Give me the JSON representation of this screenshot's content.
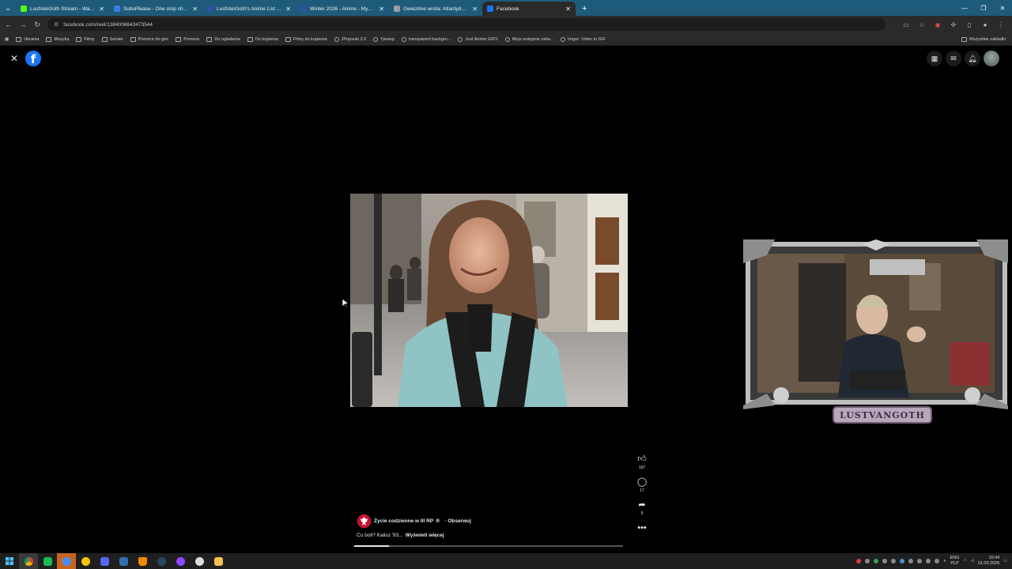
{
  "browser": {
    "tabs": [
      {
        "title": "LustVanGoth Stream - Watch Li",
        "favicon_color": "#53fc18",
        "active": false
      },
      {
        "title": "SubsPlease - One stop shop fo",
        "favicon_color": "#3b7de0",
        "active": false
      },
      {
        "title": "LustVanGoth's Anime List - My",
        "favicon_color": "#2e51a2",
        "active": false
      },
      {
        "title": "Winter 2026 - Anime - MyAnim",
        "favicon_color": "#2e51a2",
        "active": false
      },
      {
        "title": "Gwiezdne wrota: Atlantyda / St",
        "favicon_color": "#9aa0a6",
        "active": false
      },
      {
        "title": "Facebook",
        "favicon_color": "#1877f2",
        "active": true
      }
    ],
    "url": "facebook.com/reel/1384006643473544",
    "bookmarks": [
      {
        "label": "Ubrania",
        "type": "folder"
      },
      {
        "label": "Muzyka",
        "type": "folder"
      },
      {
        "label": "Filmy",
        "type": "folder"
      },
      {
        "label": "Seriale",
        "type": "folder"
      },
      {
        "label": "Pomoce do gier",
        "type": "folder"
      },
      {
        "label": "Pomoce",
        "type": "folder"
      },
      {
        "label": "Do ogladania",
        "type": "folder"
      },
      {
        "label": "Do kupienia",
        "type": "folder"
      },
      {
        "label": "Filmy do kupienia",
        "type": "folder"
      },
      {
        "label": "JPopsuki 2.0",
        "type": "link"
      },
      {
        "label": "Трекер",
        "type": "link"
      },
      {
        "label": "transparent backgro...",
        "type": "link"
      },
      {
        "label": "Just Anime GIFS",
        "type": "link"
      },
      {
        "label": "Moje wstępnie zatw...",
        "type": "link"
      },
      {
        "label": "Imgur: Video to GIF",
        "type": "link"
      }
    ],
    "all_bookmarks_label": "Wszystkie zakładki"
  },
  "reel": {
    "author": "Życie codzienne w III RP",
    "follow_label": "· Obserwuj",
    "caption": "Co boli? Kalisz '93...",
    "see_more": "Wyświetl więcej",
    "likes": "167",
    "comments": "17",
    "shares": "9",
    "progress_fraction": 0.13
  },
  "stream_overlay": {
    "name": "LUSTVANGOTH"
  },
  "taskbar": {
    "lang_top": "ENG",
    "lang_bottom": "PLP",
    "time": "10:44",
    "date": "01.03.2026"
  },
  "colors": {
    "tabbar": "#1e5b7a",
    "facebook_blue": "#1877f2"
  }
}
